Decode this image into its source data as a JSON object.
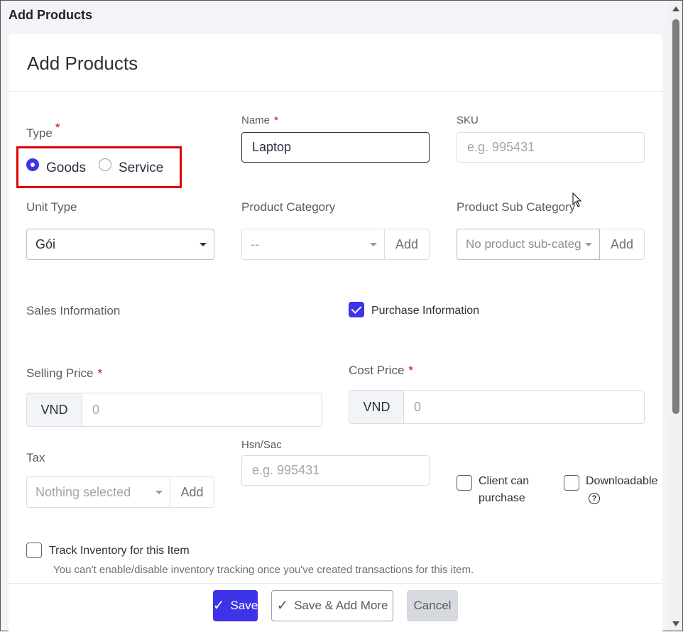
{
  "window": {
    "title": "Add Products"
  },
  "form": {
    "title": "Add Products",
    "type": {
      "label": "Type",
      "required": "*",
      "options": [
        {
          "label": "Goods",
          "selected": true
        },
        {
          "label": "Service",
          "selected": false
        }
      ]
    },
    "name": {
      "label": "Name",
      "required": "*",
      "value": "Laptop"
    },
    "sku": {
      "label": "SKU",
      "placeholder": "e.g. 995431"
    },
    "unit_type": {
      "label": "Unit Type",
      "value": "Gói"
    },
    "product_category": {
      "label": "Product Category",
      "value": "--",
      "add_label": "Add"
    },
    "product_sub_category": {
      "label": "Product Sub Category",
      "value": "No product sub-categ",
      "add_label": "Add"
    },
    "sales_information": {
      "label": "Sales Information"
    },
    "purchase_information": {
      "label": "Purchase Information",
      "checked": true
    },
    "selling_price": {
      "label": "Selling Price",
      "required": "*",
      "currency": "VND",
      "placeholder": "0"
    },
    "cost_price": {
      "label": "Cost Price",
      "required": "*",
      "currency": "VND",
      "placeholder": "0"
    },
    "tax": {
      "label": "Tax",
      "value": "Nothing selected",
      "add_label": "Add"
    },
    "hsn_sac": {
      "label": "Hsn/Sac",
      "placeholder": "e.g. 995431"
    },
    "client_can_purchase": {
      "line1": "Client can",
      "line2": "purchase",
      "checked": false
    },
    "downloadable": {
      "label": "Downloadable",
      "help": "?",
      "checked": false
    },
    "track_inventory": {
      "label": "Track Inventory for this Item",
      "hint": "You can't enable/disable inventory tracking once you've created transactions for this item.",
      "checked": false
    }
  },
  "footer": {
    "save": "Save",
    "save_add_more": "Save & Add More",
    "cancel": "Cancel"
  },
  "colors": {
    "primary": "#3d33e7",
    "required": "#d30000",
    "highlight": "#e00000"
  }
}
